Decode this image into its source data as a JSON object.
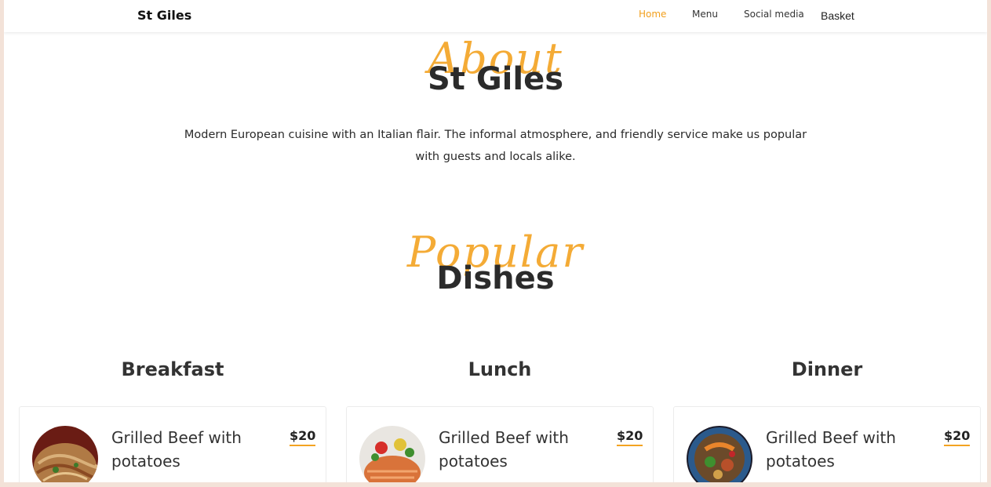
{
  "nav": {
    "brand": "St Giles",
    "links": [
      "Home",
      "Menu",
      "Social media",
      "Basket"
    ],
    "active": "Home"
  },
  "about": {
    "script": "About",
    "title": "St Giles",
    "text_line1": "Modern European cuisine with an Italian flair. The informal atmosphere, and friendly service make us popular",
    "text_line2": "with guests and locals alike."
  },
  "popular": {
    "script": "Popular",
    "title": "Dishes"
  },
  "categories": [
    "Breakfast",
    "Lunch",
    "Dinner"
  ],
  "dishes": [
    {
      "title": "Grilled Beef with potatoes",
      "price": "$20",
      "image": "noodles"
    },
    {
      "title": "Grilled Beef with potatoes",
      "price": "$20",
      "image": "salmon"
    },
    {
      "title": "Grilled Beef with potatoes",
      "price": "$20",
      "image": "salad-bowl"
    }
  ],
  "colors": {
    "accent": "#f3a321",
    "text": "#2b2b2b",
    "background": "#f3e2d8"
  }
}
